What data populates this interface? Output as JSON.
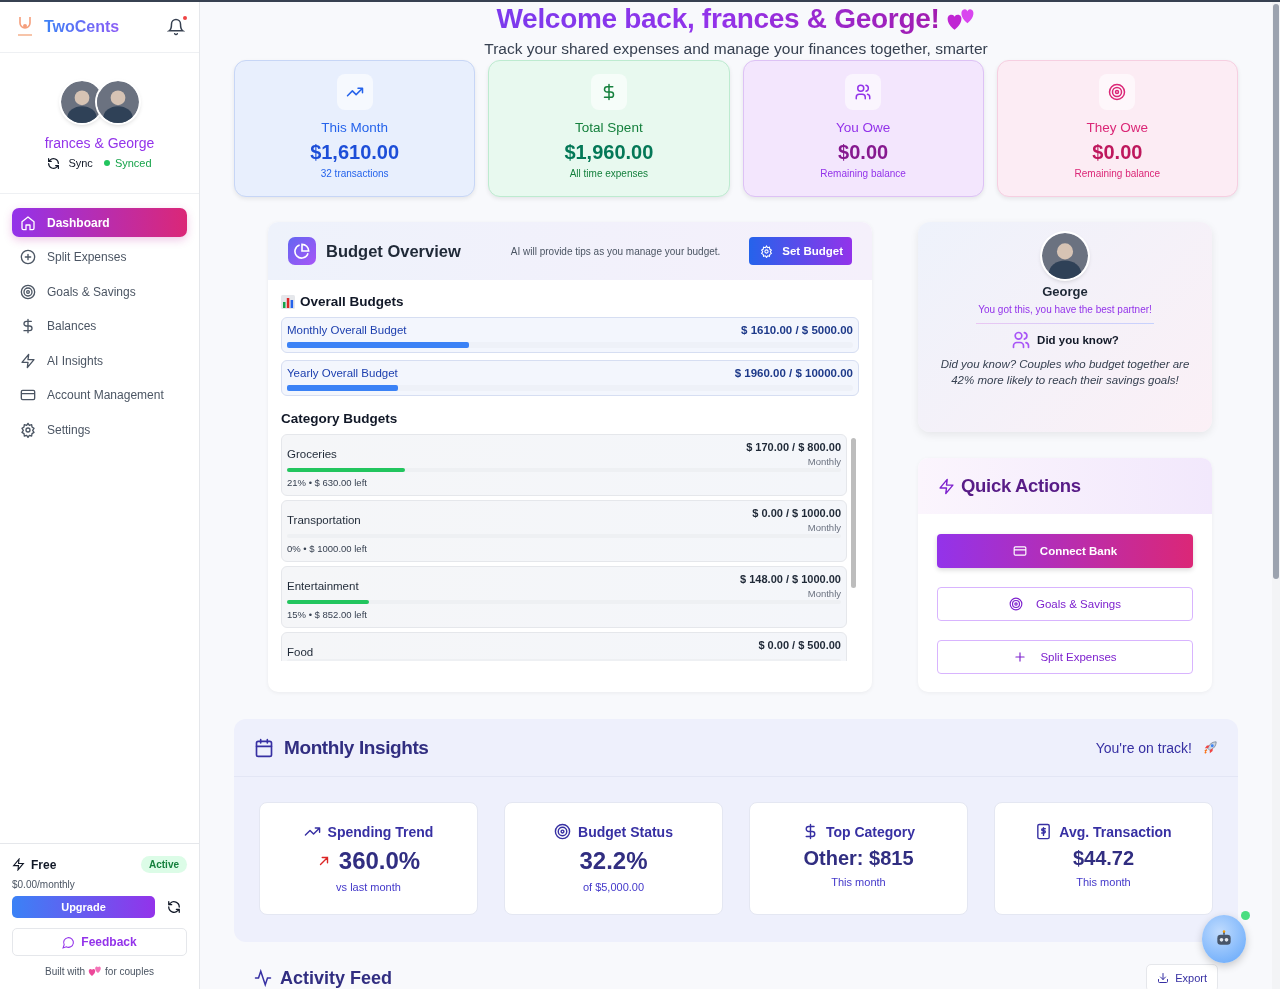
{
  "app": {
    "name": "TwoCents",
    "notification_dot": true
  },
  "profile": {
    "names": "frances & George",
    "sync_label": "Sync",
    "status": "Synced"
  },
  "nav": [
    {
      "label": "Dashboard",
      "selected": true
    },
    {
      "label": "Split Expenses",
      "selected": false
    },
    {
      "label": "Goals & Savings",
      "selected": false
    },
    {
      "label": "Balances",
      "selected": false
    },
    {
      "label": "AI Insights",
      "selected": false
    },
    {
      "label": "Account Management",
      "selected": false
    },
    {
      "label": "Settings",
      "selected": false
    }
  ],
  "plan": {
    "name": "Free",
    "badge": "Active",
    "price": "$0.00/monthly",
    "upgrade": "Upgrade",
    "feedback": "Feedback",
    "footer_before": "Built with",
    "footer_after": "for couples"
  },
  "header": {
    "title": "Welcome back, frances & George!",
    "subtitle": "Track your shared expenses and manage your finances together, smarter"
  },
  "stats": [
    {
      "label": "This Month",
      "value": "$1,610.00",
      "note": "32 transactions"
    },
    {
      "label": "Total Spent",
      "value": "$1,960.00",
      "note": "All time expenses"
    },
    {
      "label": "You Owe",
      "value": "$0.00",
      "note": "Remaining balance"
    },
    {
      "label": "They Owe",
      "value": "$0.00",
      "note": "Remaining balance"
    }
  ],
  "budget": {
    "title": "Budget Overview",
    "tip": "AI will provide tips as you manage your budget.",
    "button": "Set Budget",
    "overall_title": "Overall Budgets",
    "overall": [
      {
        "name": "Monthly Overall Budget",
        "amount": "$ 1610.00 / $ 5000.00",
        "level": 0.322
      },
      {
        "name": "Yearly Overall Budget",
        "amount": "$ 1960.00 / $ 10000.00",
        "level": 0.196
      }
    ],
    "category_title": "Category Budgets",
    "categories": [
      {
        "name": "Groceries",
        "amount": "$ 170.00 / $ 800.00",
        "period": "Monthly",
        "level": 0.2125,
        "summary": "21% • $ 630.00 left"
      },
      {
        "name": "Transportation",
        "amount": "$ 0.00 / $ 1000.00",
        "period": "Monthly",
        "summary": "0% • $ 1000.00 left"
      },
      {
        "name": "Entertainment",
        "amount": "$ 148.00 / $ 1000.00",
        "period": "Monthly",
        "level": 0.148,
        "summary": "15% • $ 852.00 left"
      },
      {
        "name": "Food",
        "amount": "$ 0.00 / $ 500.00"
      }
    ]
  },
  "partner": {
    "name": "George",
    "message": "You got this, you have the best partner!",
    "fact_title": "Did you know?",
    "fact": "Did you know? Couples who budget together are 42% more likely to reach their savings goals!"
  },
  "quick_actions": {
    "title": "Quick Actions",
    "buttons": [
      {
        "label": "Connect Bank",
        "kind": "primary"
      },
      {
        "label": "Goals & Savings",
        "kind": "outline"
      },
      {
        "label": "Split Expenses",
        "kind": "outline"
      }
    ]
  },
  "insights": {
    "title": "Monthly Insights",
    "status": "You're on track!",
    "cards": [
      {
        "label": "Spending Trend",
        "value": "360.0%",
        "note": "vs last month"
      },
      {
        "label": "Budget Status",
        "value": "32.2%",
        "note": "of $5,000.00"
      },
      {
        "label": "Top Category",
        "value": "Other: $815",
        "note": "This month"
      },
      {
        "label": "Avg. Transaction",
        "value": "$44.72",
        "note": "This month"
      }
    ]
  },
  "activity": {
    "title": "Activity Feed",
    "export": "Export"
  }
}
